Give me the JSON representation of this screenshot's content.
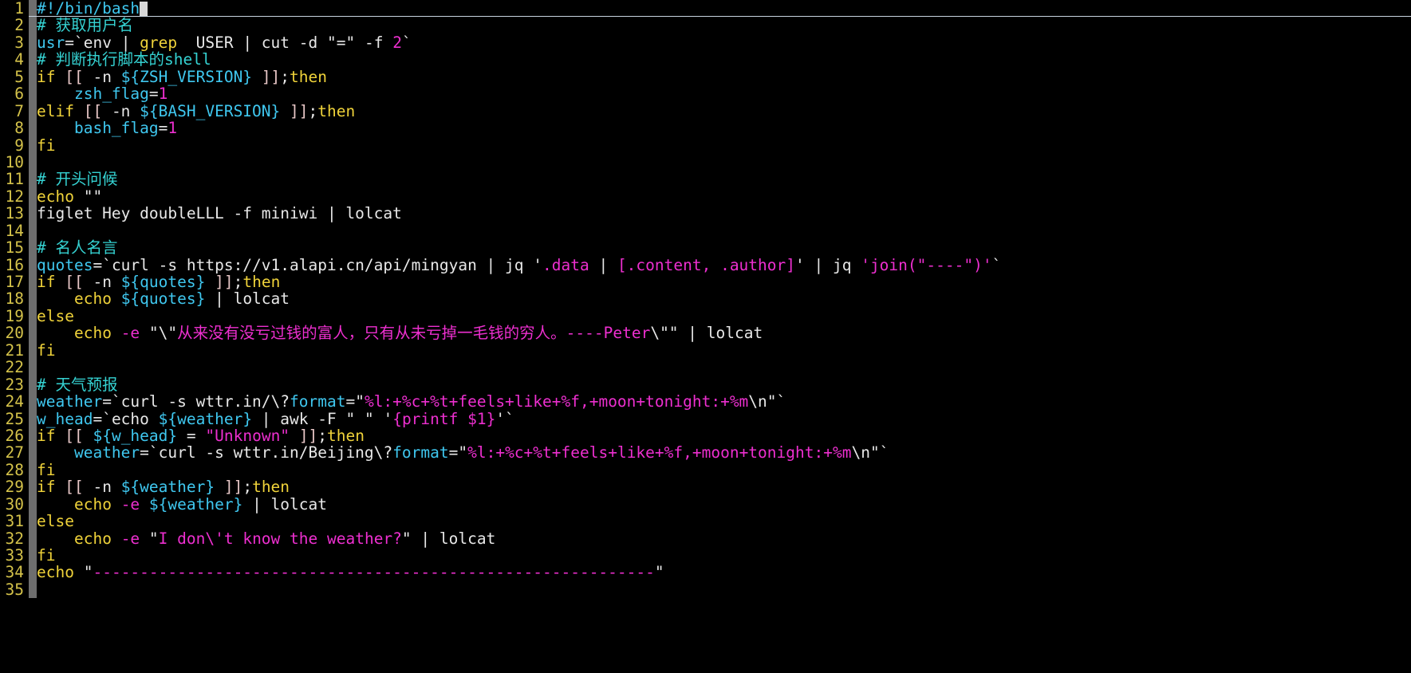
{
  "editor": {
    "language": "shell-script",
    "theme": "dark-terminal",
    "background_color": "#000000",
    "line_number_color": "#d4c24a",
    "fold_bar_color": "#6e6e6e",
    "cursor_line": 1,
    "total_lines_visible": 35,
    "colors": {
      "comment": "#35d2d2",
      "keyword": "#f0d33a",
      "variable": "#3fc7ef",
      "string": "#ee2fd0",
      "plain": "#e8e8e8",
      "bracket": "#e8c7c7"
    }
  },
  "lines": [
    {
      "num": "1",
      "cursor": true,
      "tokens": [
        {
          "t": "#!/bin/bash",
          "c": "t-var"
        }
      ]
    },
    {
      "num": "2",
      "tokens": [
        {
          "t": "# 获取用户名",
          "c": "t-comment"
        }
      ]
    },
    {
      "num": "3",
      "tokens": [
        {
          "t": "usr",
          "c": "t-var"
        },
        {
          "t": "=",
          "c": "t-plain"
        },
        {
          "t": "`env ",
          "c": "t-plain"
        },
        {
          "t": "| ",
          "c": "t-plain"
        },
        {
          "t": "grep",
          "c": "t-keyword"
        },
        {
          "t": "  USER | cut ",
          "c": "t-plain"
        },
        {
          "t": "-d",
          "c": "t-plain"
        },
        {
          "t": " ",
          "c": "t-plain"
        },
        {
          "t": "\"=\"",
          "c": "t-plain"
        },
        {
          "t": " -f ",
          "c": "t-plain"
        },
        {
          "t": "2",
          "c": "t-num"
        },
        {
          "t": "`",
          "c": "t-plain"
        }
      ]
    },
    {
      "num": "4",
      "tokens": [
        {
          "t": "# 判断执行脚本的shell",
          "c": "t-comment"
        }
      ]
    },
    {
      "num": "5",
      "tokens": [
        {
          "t": "if",
          "c": "t-keyword"
        },
        {
          "t": " ",
          "c": "t-plain"
        },
        {
          "t": "[[",
          "c": "t-bracket"
        },
        {
          "t": " -n ",
          "c": "t-plain"
        },
        {
          "t": "${ZSH_VERSION}",
          "c": "t-var"
        },
        {
          "t": " ",
          "c": "t-plain"
        },
        {
          "t": "]]",
          "c": "t-bracket"
        },
        {
          "t": ";",
          "c": "t-plain"
        },
        {
          "t": "then",
          "c": "t-keyword"
        }
      ]
    },
    {
      "num": "6",
      "tokens": [
        {
          "t": "    ",
          "c": "t-plain"
        },
        {
          "t": "zsh_flag",
          "c": "t-var"
        },
        {
          "t": "=",
          "c": "t-plain"
        },
        {
          "t": "1",
          "c": "t-num"
        }
      ]
    },
    {
      "num": "7",
      "tokens": [
        {
          "t": "elif",
          "c": "t-keyword"
        },
        {
          "t": " ",
          "c": "t-plain"
        },
        {
          "t": "[[",
          "c": "t-bracket"
        },
        {
          "t": " -n ",
          "c": "t-plain"
        },
        {
          "t": "${BASH_VERSION}",
          "c": "t-var"
        },
        {
          "t": " ",
          "c": "t-plain"
        },
        {
          "t": "]]",
          "c": "t-bracket"
        },
        {
          "t": ";",
          "c": "t-plain"
        },
        {
          "t": "then",
          "c": "t-keyword"
        }
      ]
    },
    {
      "num": "8",
      "tokens": [
        {
          "t": "    ",
          "c": "t-plain"
        },
        {
          "t": "bash_flag",
          "c": "t-var"
        },
        {
          "t": "=",
          "c": "t-plain"
        },
        {
          "t": "1",
          "c": "t-num"
        }
      ]
    },
    {
      "num": "9",
      "tokens": [
        {
          "t": "fi",
          "c": "t-keyword"
        }
      ]
    },
    {
      "num": "10",
      "tokens": []
    },
    {
      "num": "11",
      "tokens": [
        {
          "t": "# 开头问候",
          "c": "t-comment"
        }
      ]
    },
    {
      "num": "12",
      "tokens": [
        {
          "t": "echo",
          "c": "t-keyword"
        },
        {
          "t": " ",
          "c": "t-plain"
        },
        {
          "t": "\"\"",
          "c": "t-plain"
        }
      ]
    },
    {
      "num": "13",
      "tokens": [
        {
          "t": "figlet Hey doubleLLL -f miniwi | lolcat",
          "c": "t-plain"
        }
      ]
    },
    {
      "num": "14",
      "tokens": []
    },
    {
      "num": "15",
      "tokens": [
        {
          "t": "# 名人名言",
          "c": "t-comment"
        }
      ]
    },
    {
      "num": "16",
      "tokens": [
        {
          "t": "quotes",
          "c": "t-var"
        },
        {
          "t": "=",
          "c": "t-plain"
        },
        {
          "t": "`curl -s https://v1.alapi.cn/api/mingyan | jq ",
          "c": "t-plain"
        },
        {
          "t": "'",
          "c": "t-plain"
        },
        {
          "t": ".data",
          "c": "t-string"
        },
        {
          "t": " | ",
          "c": "t-plain"
        },
        {
          "t": "[.content, .author]",
          "c": "t-string"
        },
        {
          "t": "'",
          "c": "t-plain"
        },
        {
          "t": " | jq ",
          "c": "t-plain"
        },
        {
          "t": "'join(\"----\")'",
          "c": "t-string"
        },
        {
          "t": "`",
          "c": "t-plain"
        }
      ]
    },
    {
      "num": "17",
      "tokens": [
        {
          "t": "if",
          "c": "t-keyword"
        },
        {
          "t": " ",
          "c": "t-plain"
        },
        {
          "t": "[[",
          "c": "t-bracket"
        },
        {
          "t": " -n ",
          "c": "t-plain"
        },
        {
          "t": "${quotes}",
          "c": "t-var"
        },
        {
          "t": " ",
          "c": "t-plain"
        },
        {
          "t": "]]",
          "c": "t-bracket"
        },
        {
          "t": ";",
          "c": "t-plain"
        },
        {
          "t": "then",
          "c": "t-keyword"
        }
      ]
    },
    {
      "num": "18",
      "tokens": [
        {
          "t": "    ",
          "c": "t-plain"
        },
        {
          "t": "echo",
          "c": "t-keyword"
        },
        {
          "t": " ",
          "c": "t-plain"
        },
        {
          "t": "${quotes}",
          "c": "t-var"
        },
        {
          "t": " | lolcat",
          "c": "t-plain"
        }
      ]
    },
    {
      "num": "19",
      "tokens": [
        {
          "t": "else",
          "c": "t-keyword"
        }
      ]
    },
    {
      "num": "20",
      "tokens": [
        {
          "t": "    ",
          "c": "t-plain"
        },
        {
          "t": "echo",
          "c": "t-keyword"
        },
        {
          "t": " ",
          "c": "t-plain"
        },
        {
          "t": "-e",
          "c": "t-flag"
        },
        {
          "t": " ",
          "c": "t-plain"
        },
        {
          "t": "\"",
          "c": "t-plain"
        },
        {
          "t": "\\\"",
          "c": "t-plain"
        },
        {
          "t": "从来没有没亏过钱的富人，只有从未亏掉一毛钱的穷人。----Peter",
          "c": "t-string"
        },
        {
          "t": "\\\"\"",
          "c": "t-plain"
        },
        {
          "t": " | lolcat",
          "c": "t-plain"
        }
      ]
    },
    {
      "num": "21",
      "tokens": [
        {
          "t": "fi",
          "c": "t-keyword"
        }
      ]
    },
    {
      "num": "22",
      "tokens": []
    },
    {
      "num": "23",
      "tokens": [
        {
          "t": "# 天气预报",
          "c": "t-comment"
        }
      ]
    },
    {
      "num": "24",
      "tokens": [
        {
          "t": "weather",
          "c": "t-var"
        },
        {
          "t": "=",
          "c": "t-plain"
        },
        {
          "t": "`curl -s wttr.in/\\?",
          "c": "t-plain"
        },
        {
          "t": "format",
          "c": "t-var"
        },
        {
          "t": "=",
          "c": "t-plain"
        },
        {
          "t": "\"",
          "c": "t-plain"
        },
        {
          "t": "%l:+%c+%t+feels+like+%f,+moon+tonight:+%m",
          "c": "t-string"
        },
        {
          "t": "\\n",
          "c": "t-plain"
        },
        {
          "t": "\"",
          "c": "t-plain"
        },
        {
          "t": "`",
          "c": "t-plain"
        }
      ]
    },
    {
      "num": "25",
      "tokens": [
        {
          "t": "w_head",
          "c": "t-var"
        },
        {
          "t": "=",
          "c": "t-plain"
        },
        {
          "t": "`echo ",
          "c": "t-plain"
        },
        {
          "t": "${weather}",
          "c": "t-var"
        },
        {
          "t": " | awk -F ",
          "c": "t-plain"
        },
        {
          "t": "\" \"",
          "c": "t-plain"
        },
        {
          "t": " ",
          "c": "t-plain"
        },
        {
          "t": "'",
          "c": "t-plain"
        },
        {
          "t": "{printf $1}",
          "c": "t-string"
        },
        {
          "t": "'",
          "c": "t-plain"
        },
        {
          "t": "`",
          "c": "t-plain"
        }
      ]
    },
    {
      "num": "26",
      "tokens": [
        {
          "t": "if",
          "c": "t-keyword"
        },
        {
          "t": " ",
          "c": "t-plain"
        },
        {
          "t": "[[",
          "c": "t-bracket"
        },
        {
          "t": " ",
          "c": "t-plain"
        },
        {
          "t": "${w_head}",
          "c": "t-var"
        },
        {
          "t": " ",
          "c": "t-plain"
        },
        {
          "t": "=",
          "c": "t-plain"
        },
        {
          "t": " ",
          "c": "t-plain"
        },
        {
          "t": "\"Unknown\"",
          "c": "t-string"
        },
        {
          "t": " ",
          "c": "t-plain"
        },
        {
          "t": "]]",
          "c": "t-bracket"
        },
        {
          "t": ";",
          "c": "t-plain"
        },
        {
          "t": "then",
          "c": "t-keyword"
        }
      ]
    },
    {
      "num": "27",
      "tokens": [
        {
          "t": "    ",
          "c": "t-plain"
        },
        {
          "t": "weather",
          "c": "t-var"
        },
        {
          "t": "=",
          "c": "t-plain"
        },
        {
          "t": "`curl -s wttr.in/Beijing\\?",
          "c": "t-plain"
        },
        {
          "t": "format",
          "c": "t-var"
        },
        {
          "t": "=",
          "c": "t-plain"
        },
        {
          "t": "\"",
          "c": "t-plain"
        },
        {
          "t": "%l:+%c+%t+feels+like+%f,+moon+tonight:+%m",
          "c": "t-string"
        },
        {
          "t": "\\n",
          "c": "t-plain"
        },
        {
          "t": "\"",
          "c": "t-plain"
        },
        {
          "t": "`",
          "c": "t-plain"
        }
      ]
    },
    {
      "num": "28",
      "tokens": [
        {
          "t": "fi",
          "c": "t-keyword"
        }
      ]
    },
    {
      "num": "29",
      "tokens": [
        {
          "t": "if",
          "c": "t-keyword"
        },
        {
          "t": " ",
          "c": "t-plain"
        },
        {
          "t": "[[",
          "c": "t-bracket"
        },
        {
          "t": " -n ",
          "c": "t-plain"
        },
        {
          "t": "${weather}",
          "c": "t-var"
        },
        {
          "t": " ",
          "c": "t-plain"
        },
        {
          "t": "]]",
          "c": "t-bracket"
        },
        {
          "t": ";",
          "c": "t-plain"
        },
        {
          "t": "then",
          "c": "t-keyword"
        }
      ]
    },
    {
      "num": "30",
      "tokens": [
        {
          "t": "    ",
          "c": "t-plain"
        },
        {
          "t": "echo",
          "c": "t-keyword"
        },
        {
          "t": " ",
          "c": "t-plain"
        },
        {
          "t": "-e",
          "c": "t-flag"
        },
        {
          "t": " ",
          "c": "t-plain"
        },
        {
          "t": "${weather}",
          "c": "t-var"
        },
        {
          "t": " | lolcat",
          "c": "t-plain"
        }
      ]
    },
    {
      "num": "31",
      "tokens": [
        {
          "t": "else",
          "c": "t-keyword"
        }
      ]
    },
    {
      "num": "32",
      "tokens": [
        {
          "t": "    ",
          "c": "t-plain"
        },
        {
          "t": "echo",
          "c": "t-keyword"
        },
        {
          "t": " ",
          "c": "t-plain"
        },
        {
          "t": "-e",
          "c": "t-flag"
        },
        {
          "t": " ",
          "c": "t-plain"
        },
        {
          "t": "\"",
          "c": "t-plain"
        },
        {
          "t": "I don\\'t know the weather?",
          "c": "t-string"
        },
        {
          "t": "\"",
          "c": "t-plain"
        },
        {
          "t": " | lolcat",
          "c": "t-plain"
        }
      ]
    },
    {
      "num": "33",
      "tokens": [
        {
          "t": "fi",
          "c": "t-keyword"
        }
      ]
    },
    {
      "num": "34",
      "tokens": [
        {
          "t": "echo",
          "c": "t-keyword"
        },
        {
          "t": " ",
          "c": "t-plain"
        },
        {
          "t": "\"",
          "c": "t-plain"
        },
        {
          "t": "------------------------------------------------------------",
          "c": "t-string"
        },
        {
          "t": "\"",
          "c": "t-plain"
        }
      ]
    },
    {
      "num": "35",
      "tokens": []
    }
  ]
}
